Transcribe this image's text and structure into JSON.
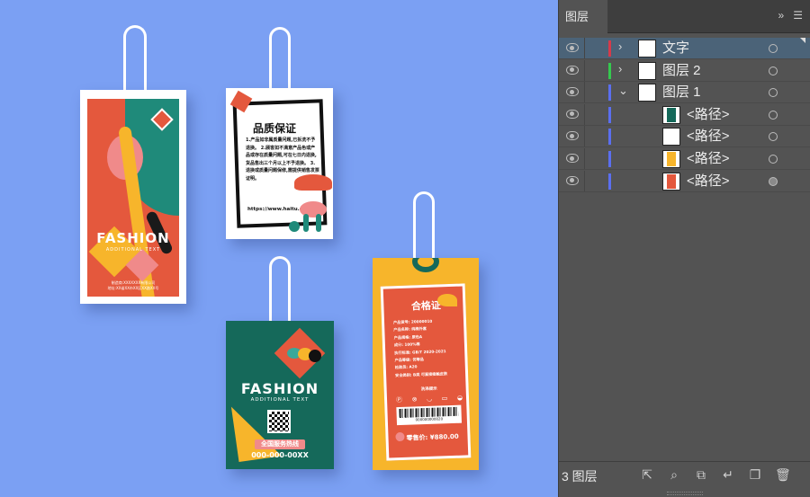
{
  "canvas": {
    "tag1": {
      "title": "FASHION",
      "subtitle": "ADDITIONAL TEXT",
      "fine_line1": "制造商:XXXXXXX有限公司",
      "fine_line2": "地址:XX省XX市XX区XX路XX号"
    },
    "tag2": {
      "title": "品质保证",
      "body": "1.产品如非属质量问题,已拆洗不予退换。 2.顾客如不满意产品色或产品或存在质量问题,可在七日内退换,货品售出三个月以上不予退换。 3.退换或质量问题保修,需提供销售发票证明。",
      "url": "https://www.haitu.com"
    },
    "tag3": {
      "title": "FASHION",
      "subtitle": "ADDITIONAL TEXT",
      "hotline": "全国服务热线",
      "phone": "000-000-00XX"
    },
    "tag4": {
      "title": "合格证",
      "lines": [
        "产品货号: 20000010",
        "产品名称: 纯棉外套",
        "产品规格: 原色A",
        "成分: 100%棉",
        "执行标准: GB/T 2020-2021",
        "产品等级: 优等品",
        "检验员: A20",
        "安全类别: B类 可直接接触皮肤"
      ],
      "wash": "洗涤提示",
      "barcode_num": "000000000020",
      "price": "零售价: ¥880.00"
    }
  },
  "panel": {
    "tab_label": "图层",
    "expand_glyph": "»",
    "menu_glyph": "☰",
    "footer_count": "3 图层",
    "layers": [
      {
        "label": "文字",
        "color": "#d63a4a",
        "arrow": "›",
        "selected": true,
        "target_filled": false,
        "indent": 0
      },
      {
        "label": "图层 2",
        "color": "#35c94e",
        "arrow": "›",
        "selected": false,
        "target_filled": false,
        "indent": 0
      },
      {
        "label": "图层 1",
        "color": "#5b6ff0",
        "arrow": "⌄",
        "selected": false,
        "target_filled": false,
        "indent": 0
      },
      {
        "label": "<路径>",
        "color": "#5b6ff0",
        "arrow": "",
        "selected": false,
        "target_filled": false,
        "indent": 1,
        "swatch": "#15695a"
      },
      {
        "label": "<路径>",
        "color": "#5b6ff0",
        "arrow": "",
        "selected": false,
        "target_filled": false,
        "indent": 1,
        "swatch": "#ffffff"
      },
      {
        "label": "<路径>",
        "color": "#5b6ff0",
        "arrow": "",
        "selected": false,
        "target_filled": false,
        "indent": 1,
        "swatch": "#f7b52b"
      },
      {
        "label": "<路径>",
        "color": "#5b6ff0",
        "arrow": "",
        "selected": false,
        "target_filled": true,
        "indent": 1,
        "swatch": "#e4583d"
      }
    ]
  }
}
